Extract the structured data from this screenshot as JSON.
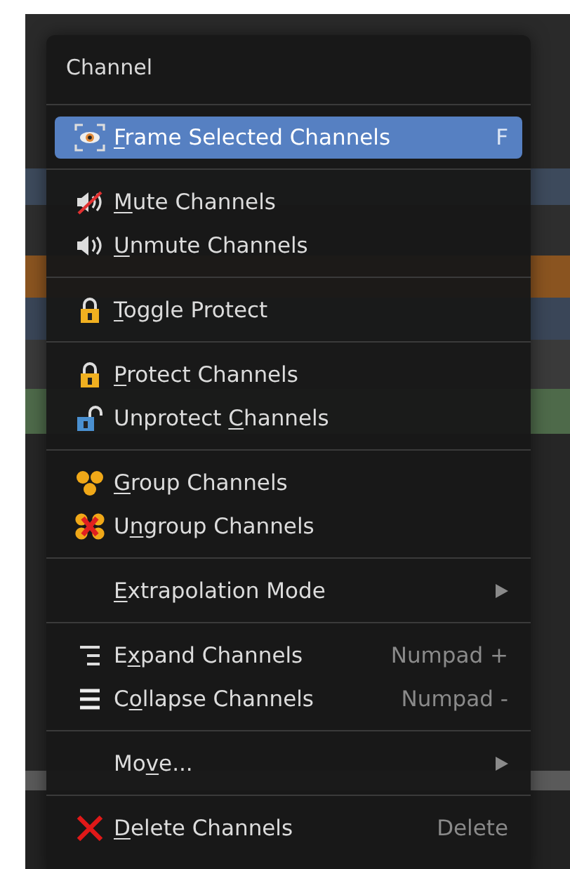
{
  "menu": {
    "title": "Channel",
    "sections": [
      {
        "items": [
          {
            "mnemonic": "F",
            "text_after": "rame Selected Channels",
            "shortcut": "F",
            "selected": true,
            "submenu": false
          }
        ]
      },
      {
        "items": [
          {
            "mnemonic": "M",
            "text_after": "ute Channels",
            "selected": false,
            "submenu": false
          },
          {
            "mnemonic": "U",
            "text_after": "nmute Channels",
            "selected": false,
            "submenu": false
          }
        ]
      },
      {
        "items": [
          {
            "mnemonic": "T",
            "text_after": "oggle Protect",
            "selected": false,
            "submenu": false
          }
        ]
      },
      {
        "items": [
          {
            "mnemonic": "P",
            "text_after": "rotect Channels",
            "selected": false,
            "submenu": false
          },
          {
            "text_before": "Unprotect ",
            "mnemonic": "C",
            "text_after": "hannels",
            "selected": false,
            "submenu": false
          }
        ]
      },
      {
        "items": [
          {
            "mnemonic": "G",
            "text_after": "roup Channels",
            "selected": false,
            "submenu": false
          },
          {
            "text_before": "U",
            "mnemonic": "n",
            "text_after": "group Channels",
            "selected": false,
            "submenu": false
          }
        ]
      },
      {
        "items": [
          {
            "mnemonic": "E",
            "text_after": "xtrapolation Mode",
            "selected": false,
            "submenu": true
          }
        ]
      },
      {
        "items": [
          {
            "text_before": "E",
            "mnemonic": "x",
            "text_after": "pand Channels",
            "shortcut": "Numpad +",
            "selected": false,
            "submenu": false
          },
          {
            "text_before": "C",
            "mnemonic": "o",
            "text_after": "llapse Channels",
            "shortcut": "Numpad -",
            "selected": false,
            "submenu": false
          }
        ]
      },
      {
        "items": [
          {
            "text_before": "Mo",
            "mnemonic": "v",
            "text_after": "e...",
            "selected": false,
            "submenu": true
          }
        ]
      },
      {
        "items": [
          {
            "mnemonic": "D",
            "text_after": "elete Channels",
            "shortcut": "Delete",
            "selected": false,
            "submenu": false
          }
        ]
      }
    ]
  }
}
